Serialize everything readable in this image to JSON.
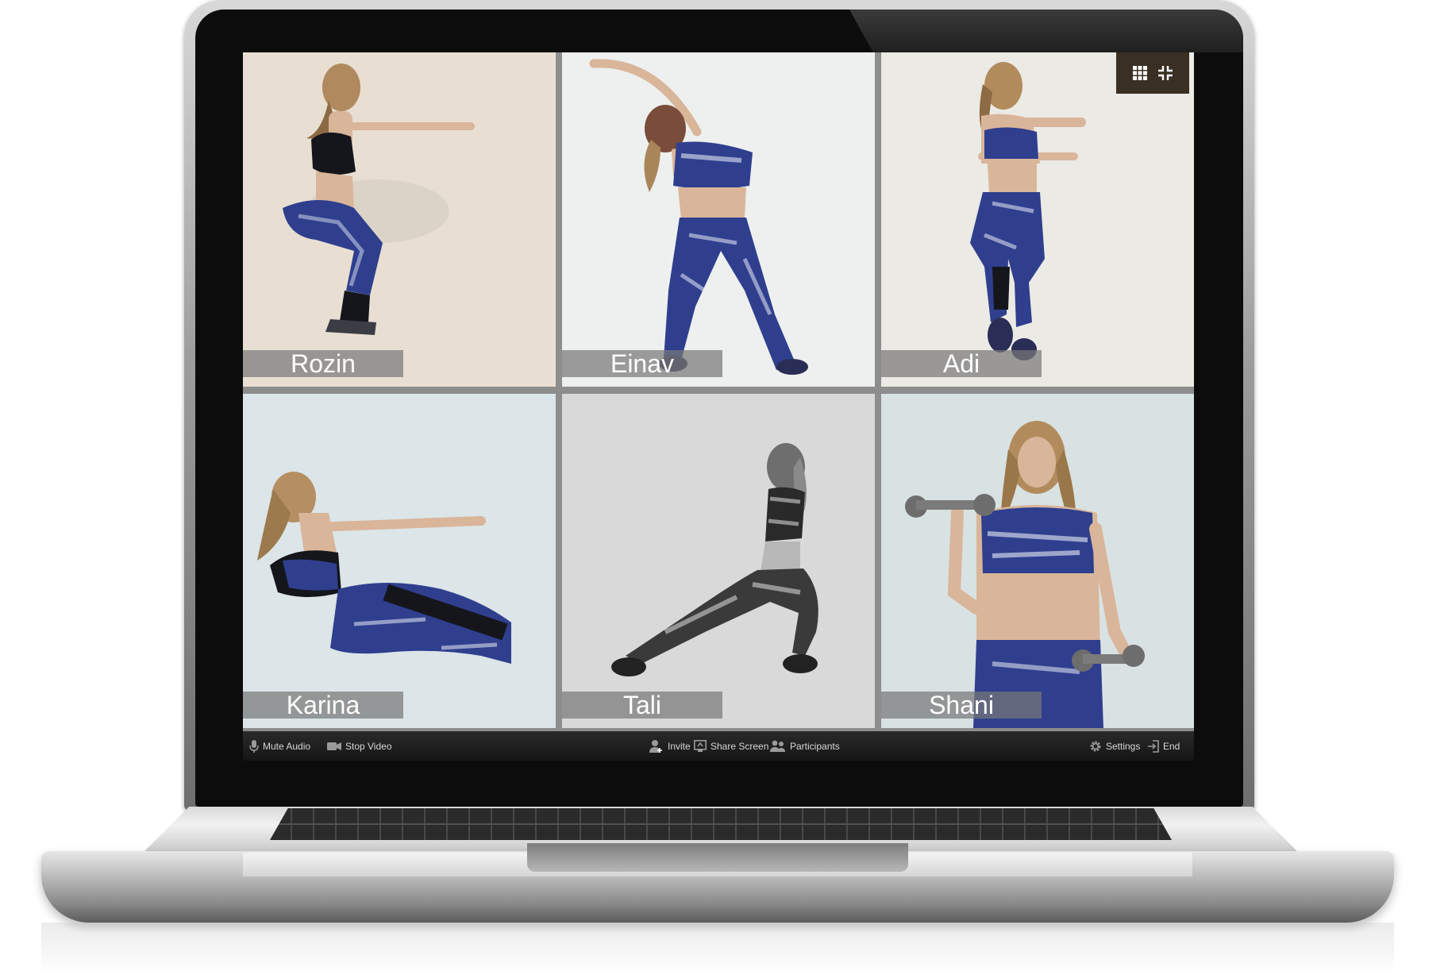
{
  "meeting": {
    "participants": [
      {
        "name": "Rozin",
        "pose": "squat",
        "bg": "#e9e1d5"
      },
      {
        "name": "Einav",
        "pose": "side-stretch",
        "bg": "#eef1ef"
      },
      {
        "name": "Adi",
        "pose": "knee-raise",
        "bg": "#ecebe6"
      },
      {
        "name": "Karina",
        "pose": "sit-up",
        "bg": "#dde6e8"
      },
      {
        "name": "Tali",
        "pose": "lunge",
        "bg": "#dcdcdc"
      },
      {
        "name": "Shani",
        "pose": "dumbbell-curl",
        "bg": "#d9e3e4"
      }
    ]
  },
  "view_controls": {
    "gallery_icon": "grid-icon",
    "exit_fullscreen_icon": "exit-fullscreen-icon"
  },
  "toolbar": {
    "mute_audio": "Mute Audio",
    "stop_video": "Stop Video",
    "invite": "Invite",
    "share_screen": "Share Screen",
    "participants": "Participants",
    "settings": "Settings",
    "end": "End"
  },
  "colors": {
    "outfit_blue": "#2f3f8e",
    "outfit_dark": "#15161c",
    "name_plate": "#787878",
    "toolbar_bg": "#1c1c1c"
  }
}
